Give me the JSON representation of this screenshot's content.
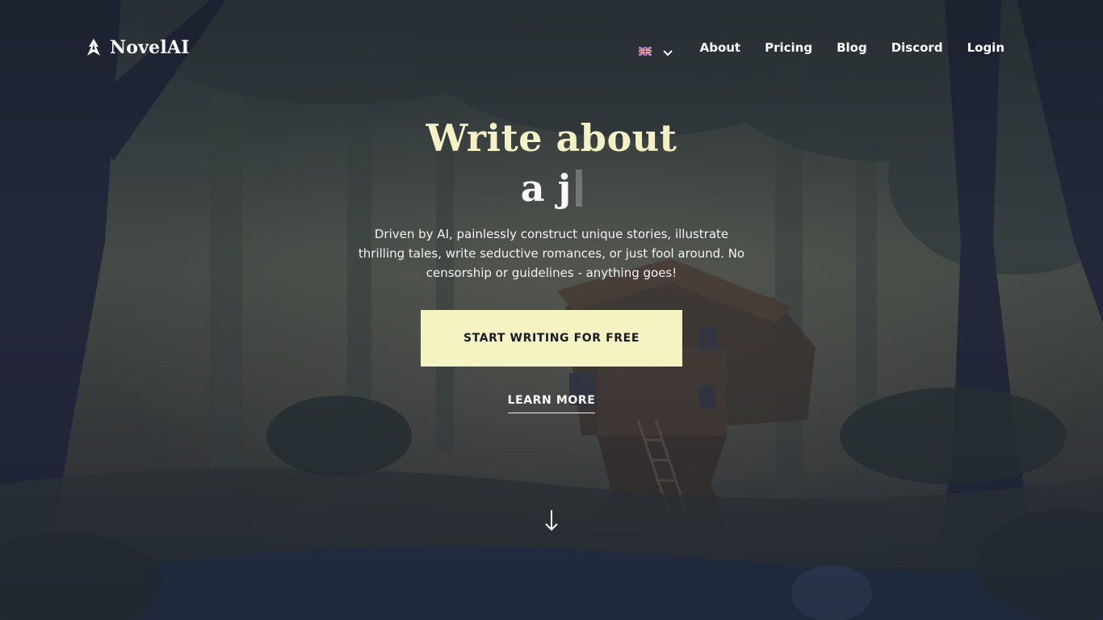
{
  "nav": {
    "brand": "NovelAI",
    "language_icon": "uk-flag-icon",
    "links": [
      "About",
      "Pricing",
      "Blog",
      "Discord",
      "Login"
    ]
  },
  "hero": {
    "headline": "Write about",
    "typed_text": "a j",
    "description": "Driven by AI, painlessly construct unique stories, illustrate thrilling tales, write seductive romances, or just fool around. No censorship or guidelines - anything goes!",
    "cta_label": "START WRITING FOR FREE",
    "learn_more_label": "LEARN MORE",
    "scroll_icon": "down-arrow-icon"
  },
  "colors": {
    "accent": "#f5f3c2",
    "headline": "#f4f1c4",
    "cta_text": "#1a1a24"
  }
}
